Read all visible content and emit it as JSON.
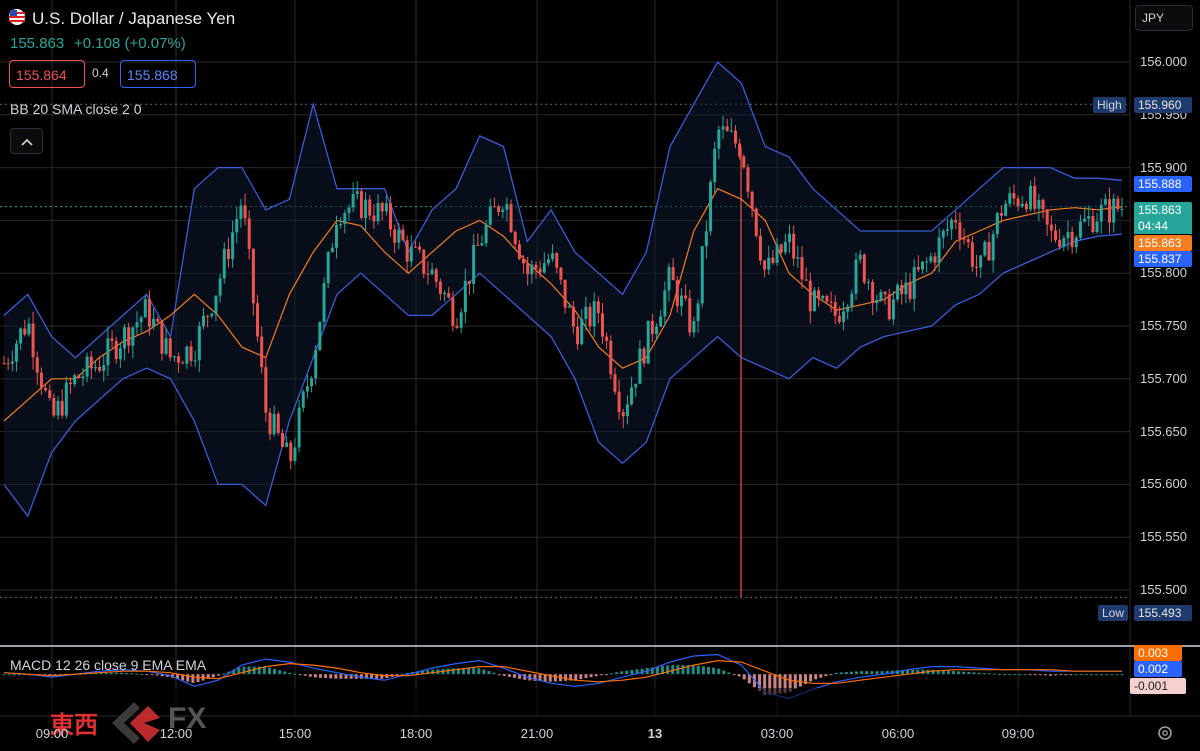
{
  "header": {
    "symbol_title": "U.S. Dollar / Japanese Yen",
    "price_line": "155.863",
    "change_line": "+0.108 (+0.07%)",
    "bid": "155.864",
    "spread": "0.4",
    "ask": "155.868",
    "indicator_bb": "BB 20 SMA close 2 0",
    "indicator_macd": "MACD 12 26 close 9 EMA EMA",
    "currency_button": "JPY",
    "collapse_icon": "chevron-up-icon",
    "flag_icon": "us-flag-icon",
    "settings_icon": "gear-icon"
  },
  "watermark": {
    "brand_text": "東西",
    "fx_text": "FX"
  },
  "price_axis": {
    "labels": [
      "156.000",
      "155.950",
      "155.900",
      "155.850",
      "155.800",
      "155.750",
      "155.700",
      "155.650",
      "155.600",
      "155.550",
      "155.500"
    ],
    "high_label": "High",
    "high_value": "155.960",
    "low_label": "Low",
    "low_value": "155.493",
    "upper_band_value": "155.888",
    "last_price": "155.863",
    "countdown": "04:44",
    "mid_value": "155.863",
    "lower_band_value": "155.837"
  },
  "macd_axis": {
    "macd_value": "0.003",
    "signal_value": "0.002",
    "hist_value": "-0.001"
  },
  "time_axis": {
    "labels": [
      "09:00",
      "12:00",
      "15:00",
      "18:00",
      "21:00",
      "13",
      "03:00",
      "06:00",
      "09:00"
    ]
  },
  "colors": {
    "up": "#26a69a",
    "down": "#ef5350",
    "band": "#3a5bd9",
    "basis": "#f57c1f",
    "macd": "#2962ff",
    "signal": "#ff6d00",
    "background": "#000000"
  },
  "chart_data": {
    "type": "candlestick",
    "title": "U.S. Dollar / Japanese Yen",
    "y_range": [
      155.493,
      156.0
    ],
    "y_ticks": [
      156.0,
      155.95,
      155.9,
      155.85,
      155.8,
      155.75,
      155.7,
      155.65,
      155.6,
      155.55,
      155.5
    ],
    "x_ticks": [
      "09:00",
      "12:00",
      "15:00",
      "18:00",
      "21:00",
      "13",
      "03:00",
      "06:00",
      "09:00"
    ],
    "high": 155.96,
    "low": 155.493,
    "last": 155.863,
    "close_path": [
      155.715,
      155.755,
      155.66,
      155.7,
      155.715,
      155.74,
      155.765,
      155.72,
      155.73,
      155.79,
      155.87,
      155.67,
      155.62,
      155.72,
      155.86,
      155.865,
      155.855,
      155.82,
      155.8,
      155.76,
      155.83,
      155.875,
      155.8,
      155.815,
      155.745,
      155.765,
      155.67,
      155.735,
      155.795,
      155.745,
      155.935,
      155.92,
      155.8,
      155.83,
      155.77,
      155.76,
      155.81,
      155.765,
      155.785,
      155.815,
      155.855,
      155.8,
      155.865,
      155.875,
      155.835,
      155.84,
      155.857,
      155.863
    ],
    "bollinger": {
      "period": 20,
      "upper": [
        155.76,
        155.78,
        155.74,
        155.72,
        155.74,
        155.76,
        155.78,
        155.74,
        155.88,
        155.9,
        155.9,
        155.86,
        155.87,
        155.96,
        155.88,
        155.88,
        155.88,
        155.82,
        155.86,
        155.88,
        155.93,
        155.92,
        155.83,
        155.86,
        155.82,
        155.8,
        155.78,
        155.82,
        155.92,
        155.96,
        156.0,
        155.98,
        155.92,
        155.91,
        155.88,
        155.86,
        155.84,
        155.84,
        155.84,
        155.84,
        155.86,
        155.88,
        155.9,
        155.9,
        155.9,
        155.89,
        155.89,
        155.888
      ],
      "basis": [
        155.66,
        155.68,
        155.7,
        155.7,
        155.72,
        155.735,
        155.745,
        155.76,
        155.78,
        155.76,
        155.73,
        155.72,
        155.78,
        155.82,
        155.85,
        155.845,
        155.82,
        155.8,
        155.82,
        155.84,
        155.85,
        155.835,
        155.81,
        155.79,
        155.765,
        155.73,
        155.71,
        155.72,
        155.76,
        155.84,
        155.88,
        155.87,
        155.85,
        155.8,
        155.78,
        155.765,
        155.77,
        155.775,
        155.79,
        155.8,
        155.83,
        155.84,
        155.85,
        155.855,
        155.86,
        155.862,
        155.86,
        155.863
      ],
      "lower": [
        155.6,
        155.57,
        155.63,
        155.66,
        155.68,
        155.7,
        155.71,
        155.7,
        155.66,
        155.6,
        155.6,
        155.58,
        155.66,
        155.72,
        155.78,
        155.8,
        155.78,
        155.76,
        155.76,
        155.78,
        155.8,
        155.78,
        155.76,
        155.74,
        155.7,
        155.64,
        155.62,
        155.64,
        155.7,
        155.72,
        155.74,
        155.72,
        155.71,
        155.7,
        155.72,
        155.71,
        155.73,
        155.74,
        155.745,
        155.75,
        155.77,
        155.78,
        155.8,
        155.81,
        155.82,
        155.83,
        155.835,
        155.837
      ]
    },
    "macd": {
      "ylim": [
        -0.025,
        0.016
      ],
      "macd": [
        0.001,
        0.0,
        -0.002,
        0.0,
        0.002,
        0.003,
        0.002,
        -0.001,
        -0.008,
        -0.004,
        0.006,
        0.01,
        0.008,
        0.004,
        0.001,
        -0.002,
        -0.004,
        0.0,
        0.004,
        0.007,
        0.009,
        0.004,
        -0.002,
        -0.006,
        -0.008,
        -0.006,
        -0.002,
        0.002,
        0.008,
        0.012,
        0.013,
        0.006,
        -0.012,
        -0.016,
        -0.01,
        -0.005,
        -0.002,
        0.0,
        0.003,
        0.005,
        0.005,
        0.004,
        0.003,
        0.003,
        0.002,
        0.002,
        0.002,
        0.002
      ],
      "signal": [
        0.001,
        0.0,
        -0.001,
        0.0,
        0.001,
        0.002,
        0.002,
        0.001,
        -0.002,
        -0.003,
        0.001,
        0.005,
        0.007,
        0.006,
        0.004,
        0.001,
        -0.001,
        -0.001,
        0.001,
        0.003,
        0.005,
        0.005,
        0.002,
        -0.001,
        -0.004,
        -0.005,
        -0.004,
        -0.002,
        0.002,
        0.006,
        0.009,
        0.008,
        0.002,
        -0.004,
        -0.006,
        -0.006,
        -0.004,
        -0.002,
        0.0,
        0.002,
        0.003,
        0.003,
        0.003,
        0.003,
        0.003,
        0.002,
        0.002,
        0.002
      ]
    }
  }
}
